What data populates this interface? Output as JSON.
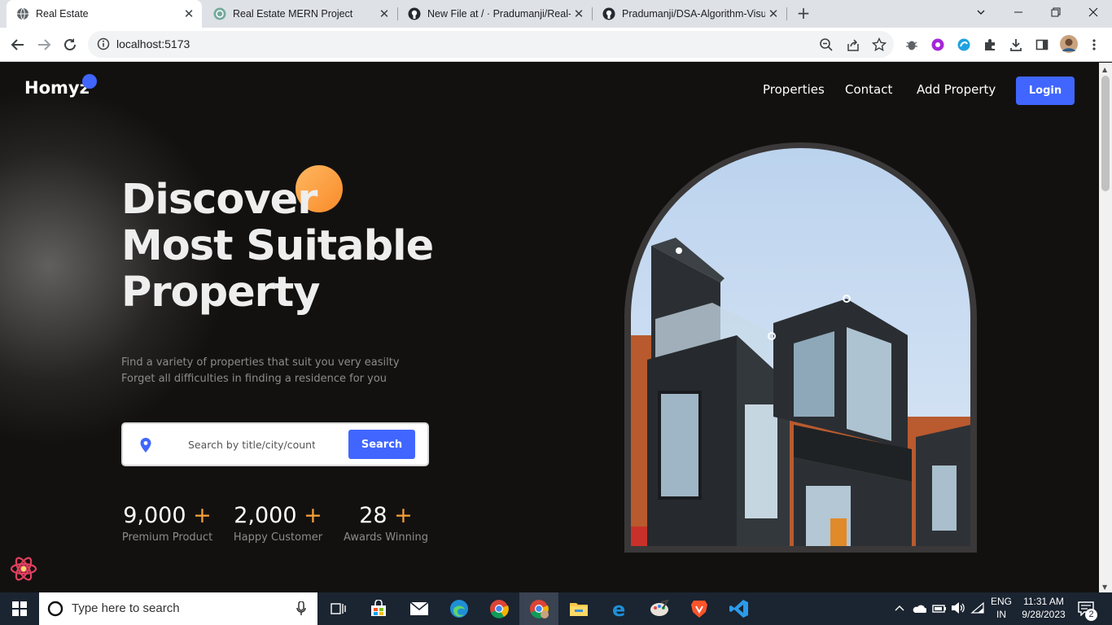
{
  "browser": {
    "tabs": [
      {
        "title": "Real Estate",
        "active": true,
        "icon": "globe-icon"
      },
      {
        "title": "Real Estate MERN Project",
        "active": false,
        "icon": "chatgpt-icon"
      },
      {
        "title": "New File at / · Pradumanji/Real-E",
        "active": false,
        "icon": "github-icon"
      },
      {
        "title": "Pradumanji/DSA-Algorithm-Visu",
        "active": false,
        "icon": "github-icon"
      }
    ],
    "url": "localhost:5173"
  },
  "header": {
    "logo": "Homyz",
    "nav": [
      "Properties",
      "Contact",
      "Add Property"
    ],
    "login_label": "Login"
  },
  "hero": {
    "title_lines": [
      "Discover",
      "Most Suitable",
      "Property"
    ],
    "description_lines": [
      "Find a variety of properties that suit you very easilty",
      "Forget all difficulties in finding a residence for you"
    ],
    "search": {
      "placeholder": "Search by title/city/country",
      "button_label": "Search"
    },
    "stats": [
      {
        "value": "9,000",
        "suffix": "+",
        "label": "Premium Product"
      },
      {
        "value": "2,000",
        "suffix": "+",
        "label": "Happy Customer"
      },
      {
        "value": "28",
        "suffix": "+",
        "label": "Awards Winning"
      }
    ]
  },
  "taskbar": {
    "search_placeholder": "Type here to search",
    "language": "ENG",
    "region": "IN",
    "time": "11:31 AM",
    "date": "9/28/2023",
    "notifications": "2"
  },
  "colors": {
    "accent_blue": "#4066ff",
    "accent_orange": "#f9a13a",
    "page_bg": "#131110"
  }
}
